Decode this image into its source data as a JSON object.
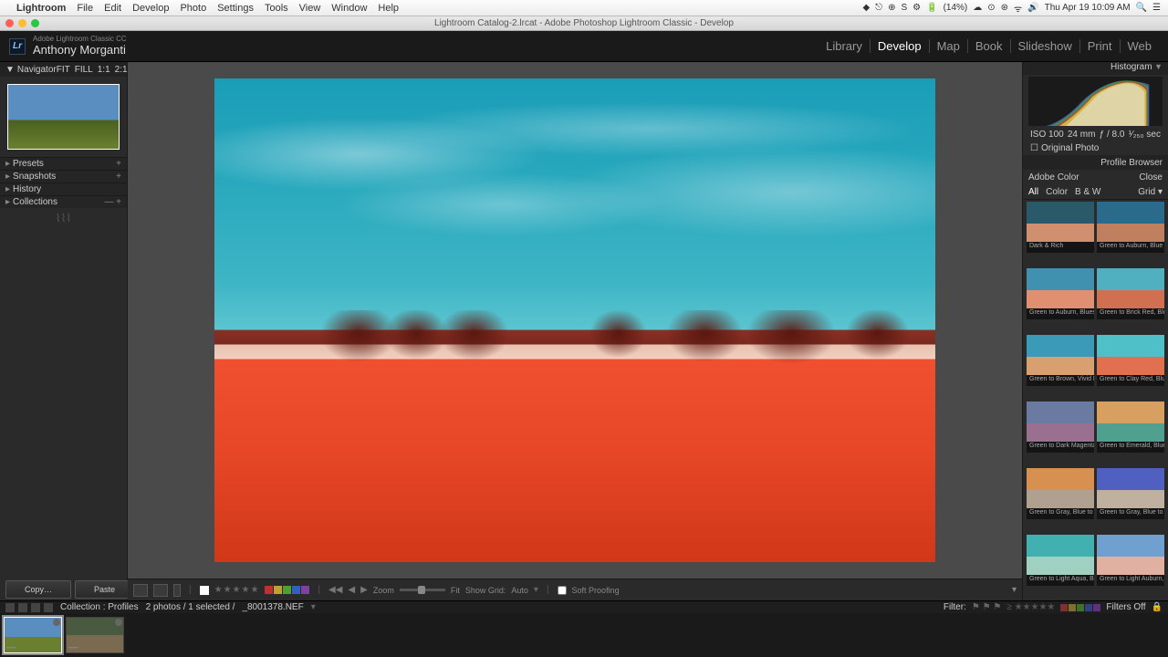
{
  "mac_menu": {
    "app": "Lightroom",
    "items": [
      "File",
      "Edit",
      "Develop",
      "Photo",
      "Settings",
      "Tools",
      "View",
      "Window",
      "Help"
    ],
    "battery": "(14%)",
    "clock": "Thu Apr 19  10:09 AM"
  },
  "window_title": "Lightroom Catalog-2.lrcat - Adobe Photoshop Lightroom Classic - Develop",
  "header": {
    "brand_small": "Adobe Lightroom Classic CC",
    "brand_big": "Anthony Morganti",
    "modules": [
      "Library",
      "Develop",
      "Map",
      "Book",
      "Slideshow",
      "Print",
      "Web"
    ],
    "active_module": "Develop"
  },
  "left": {
    "navigator": "Navigator",
    "zoom_opts": [
      "FIT",
      "FILL",
      "1:1",
      "2:1"
    ],
    "sections": [
      "Presets",
      "Snapshots",
      "History",
      "Collections"
    ]
  },
  "toolbar": {
    "zoom_label": "Zoom",
    "fit_label": "Fit",
    "showgrid_label": "Show Grid:",
    "auto_label": "Auto",
    "soft_proof": "Soft Proofing"
  },
  "bottom_btns": {
    "copy": "Copy…",
    "paste": "Paste"
  },
  "right": {
    "histogram_label": "Histogram",
    "histo_info": {
      "iso": "ISO 100",
      "focal": "24 mm",
      "aperture": "ƒ / 8.0",
      "shutter": "¹⁄₂₅₀ sec"
    },
    "original_photo": "Original Photo",
    "profile_browser": "Profile Browser",
    "profile_name": "Adobe Color",
    "close": "Close",
    "filters": [
      "All",
      "Color",
      "B & W"
    ],
    "grid_label": "Grid",
    "profiles": [
      {
        "label": "Dark & Rich",
        "bg": "linear-gradient(to bottom,#2a5a6a 55%,#d09070 55%)"
      },
      {
        "label": "Green to Auburn, Blue to D…",
        "bg": "linear-gradient(to bottom,#2a6a8a 55%,#c08060 55%)"
      },
      {
        "label": "Green to Auburn, Blues Co…",
        "bg": "linear-gradient(to bottom,#4090b0 55%,#e09070 55%)"
      },
      {
        "label": "Green to Brick Red, Blue to…",
        "bg": "linear-gradient(to bottom,#50b0c0 55%,#d07050 55%)"
      },
      {
        "label": "Green to Brown, Vivid Blues…",
        "bg": "linear-gradient(to bottom,#3a9ab8 55%,#d8a070 55%)"
      },
      {
        "label": "Green to Clay Red, Blue to A…",
        "bg": "linear-gradient(to bottom,#50c0c8 55%,#e07050 55%)"
      },
      {
        "label": "Green to Dark Magenta, Blu…",
        "bg": "linear-gradient(to bottom,#6a7aa0 55%,#9a7090 55%)"
      },
      {
        "label": "Green to Emerald, Blue to Y…",
        "bg": "linear-gradient(to bottom,#d8a060 55%,#50a090 55%)"
      },
      {
        "label": "Green to Gray, Blue to Orange",
        "bg": "linear-gradient(to bottom,#d89050 55%,#b0a090 55%)"
      },
      {
        "label": "Green to Gray, Blue to Royal…",
        "bg": "linear-gradient(to bottom,#5060c0 55%,#c0b0a0 55%)"
      },
      {
        "label": "Green to Light Aqua, Blue t…",
        "bg": "linear-gradient(to bottom,#40b0b0 55%,#a0d0c0 55%)"
      },
      {
        "label": "Green to Light Auburn, Blu…",
        "bg": "linear-gradient(to bottom,#70a0d0 55%,#e0b0a0 55%)"
      }
    ]
  },
  "secondary": {
    "collection": "Collection : Profiles",
    "count": "2 photos / 1 selected /",
    "filename": "_8001378.NEF",
    "filter": "Filter:",
    "filters_off": "Filters Off"
  },
  "filmstrip": [
    {
      "bg": "linear-gradient(to bottom,#5a8dc0 55%,#6a8030 55%)",
      "selected": true
    },
    {
      "bg": "linear-gradient(to bottom,#4a5a40 50%,#7a6a50 50%)",
      "selected": false
    }
  ]
}
